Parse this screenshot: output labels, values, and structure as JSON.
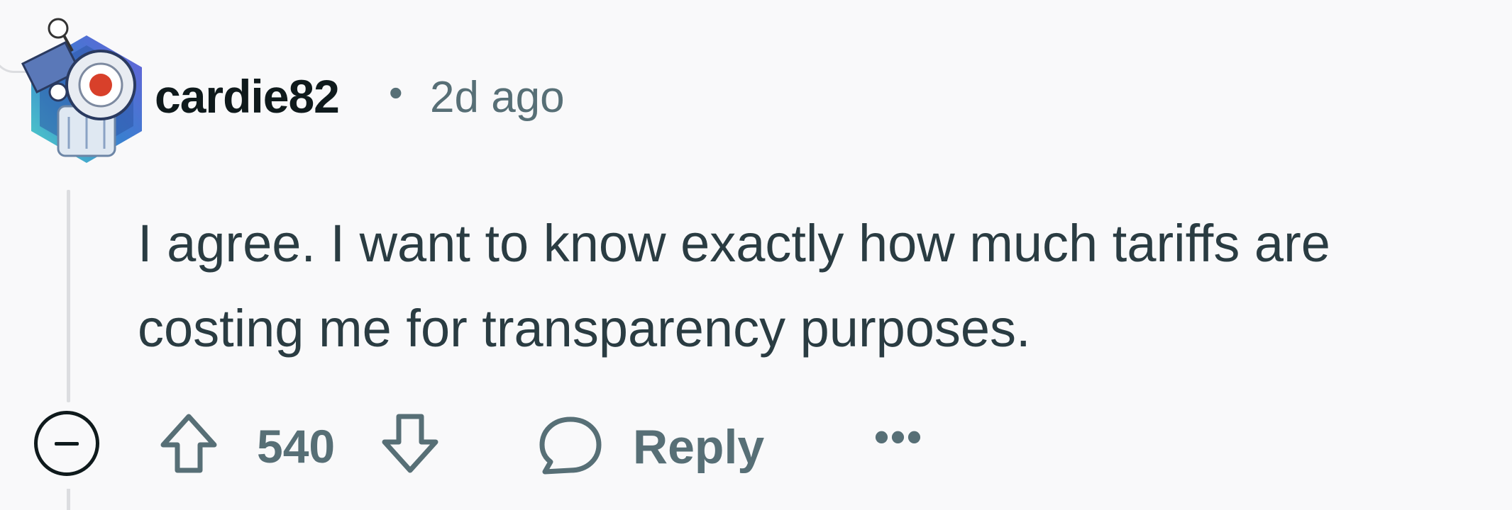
{
  "comment": {
    "author": "cardie82",
    "separator": "•",
    "time_ago": "2d ago",
    "body": "I agree. I want to know exactly how much tariffs are costing me for transparency purposes.",
    "score": "540",
    "reply_label": "Reply",
    "more_label": "•••"
  },
  "icons": {
    "collapse": "collapse-minus-icon",
    "upvote": "arrow-up-icon",
    "downvote": "arrow-down-icon",
    "reply": "speech-bubble-icon",
    "more": "ellipsis-icon"
  },
  "colors": {
    "background": "#f9f9fa",
    "text_primary": "#0f1a1c",
    "text_secondary": "#576f76",
    "body_text": "#2a3c42",
    "thread_line": "#dcdde0"
  }
}
